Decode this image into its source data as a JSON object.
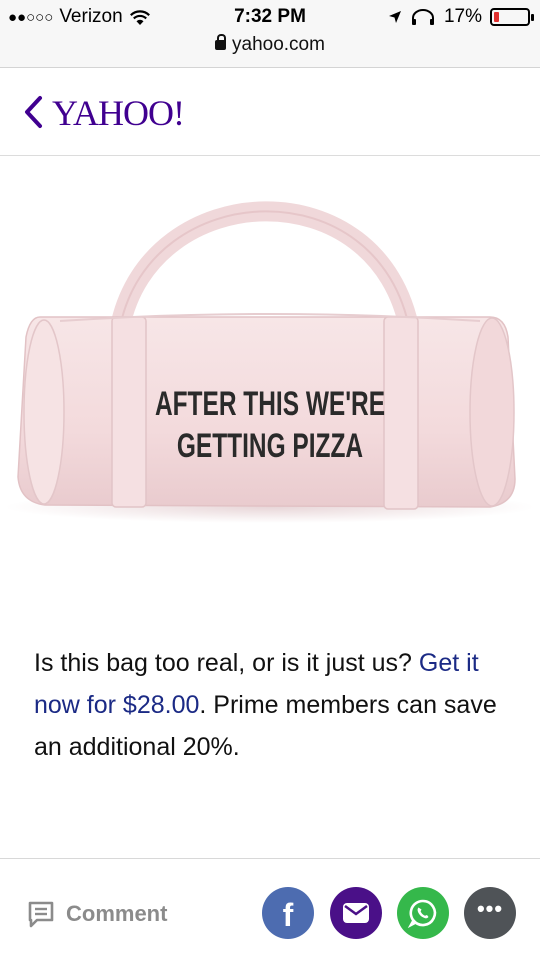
{
  "status_bar": {
    "signal": "●●○○○",
    "carrier": "Verizon",
    "time": "7:32 PM",
    "battery_percent": "17%",
    "battery_level": 0.17,
    "url": "yahoo.com"
  },
  "header": {
    "logo_text": "YAHOO!",
    "back_icon": "chevron-left-icon",
    "logo_color": "#400090"
  },
  "product_image": {
    "bag_text_line1": "AFTER THIS WE'RE",
    "bag_text_line2": "GETTING PIZZA",
    "bag_color": "#f4dfe1"
  },
  "article": {
    "text_intro": "Is this bag too real, or is it just us? ",
    "link_text": "Get it now for $28.00",
    "text_after": ". Prime members can save an additional 20%.",
    "link_color": "#1b2a85"
  },
  "footer": {
    "comment_label": "Comment",
    "share_buttons": [
      {
        "icon": "facebook-icon",
        "color": "#4d6cb0"
      },
      {
        "icon": "mail-icon",
        "color": "#4a1088"
      },
      {
        "icon": "whatsapp-icon",
        "color": "#35b84b"
      },
      {
        "icon": "more-icon",
        "color": "#4f5357"
      }
    ]
  }
}
